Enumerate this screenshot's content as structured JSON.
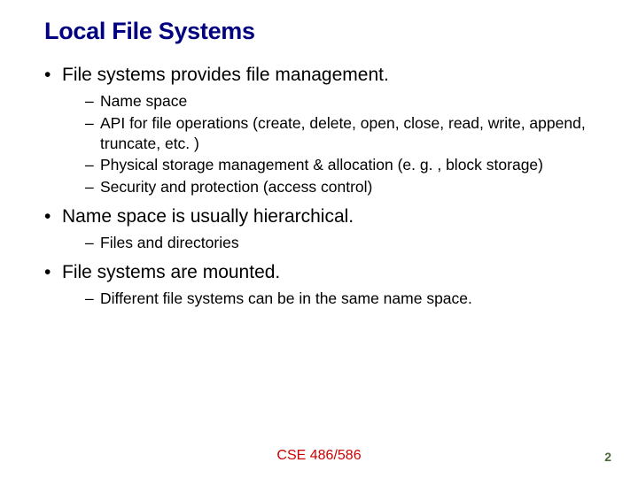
{
  "title": "Local File Systems",
  "bullets": [
    {
      "text": "File systems provides file management.",
      "subs": [
        "Name space",
        "API for file operations (create, delete, open, close, read, write, append, truncate, etc. )",
        "Physical storage management & allocation (e. g. , block storage)",
        "Security and protection (access control)"
      ]
    },
    {
      "text": "Name space is usually hierarchical.",
      "subs": [
        "Files and directories"
      ]
    },
    {
      "text": "File systems are mounted.",
      "subs": [
        "Different file systems can be in the same name space."
      ]
    }
  ],
  "footer": "CSE 486/586",
  "page": "2"
}
